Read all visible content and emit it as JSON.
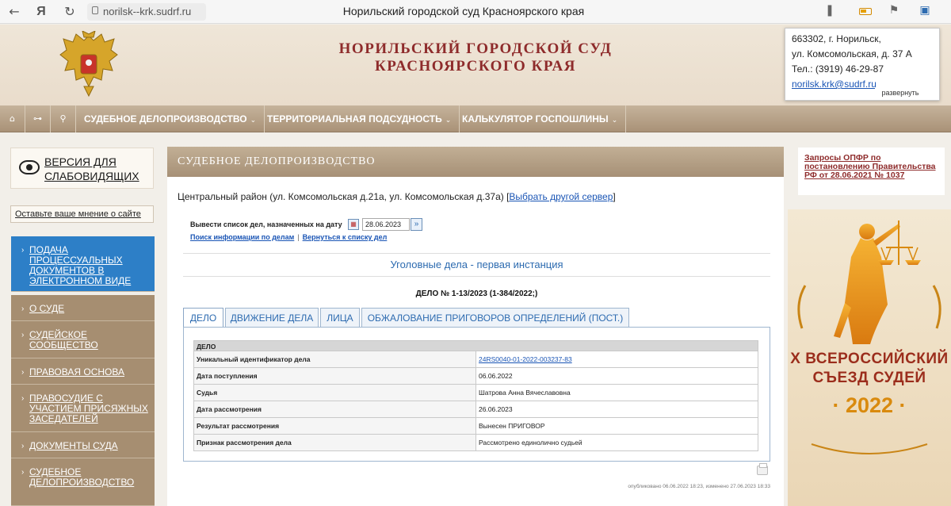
{
  "browser": {
    "url": "norilsk--krk.sudrf.ru",
    "tab_title": "Норильский городской суд Красноярского края"
  },
  "header": {
    "title_line1": "НОРИЛЬСКИЙ ГОРОДСКОЙ СУД",
    "title_line2": "КРАСНОЯРСКОГО КРАЯ",
    "contact": {
      "address1": "663302, г. Норильск,",
      "address2": "ул. Комсомольская, д. 37 А",
      "phone": "Тел.: (3919) 46-29-87",
      "email": "norilsk.krk@sudrf.ru",
      "expand_label": "развернуть"
    }
  },
  "topmenu": {
    "items": [
      "СУДЕБНОЕ ДЕЛОПРОИЗВОДСТВО",
      "ТЕРРИТОРИАЛЬНАЯ ПОДСУДНОСТЬ",
      "КАЛЬКУЛЯТОР ГОСПОШЛИНЫ"
    ],
    "chevron": "⌄"
  },
  "left": {
    "visually_impaired_line1": "ВЕРСИЯ ДЛЯ",
    "visually_impaired_line2": "СЛАБОВИДЯЩИХ",
    "feedback": "Оставьте ваше мнение о сайте",
    "nav": [
      {
        "lines": [
          "ПОДАЧА",
          "ПРОЦЕССУАЛЬНЫХ",
          "ДОКУМЕНТОВ В",
          "ЭЛЕКТРОННОМ ВИДЕ"
        ],
        "active": true
      },
      {
        "lines": [
          "О СУДЕ"
        ],
        "active": false
      },
      {
        "lines": [
          "СУДЕЙСКОЕ",
          "СООБЩЕСТВО"
        ],
        "active": false
      },
      {
        "lines": [
          "ПРАВОВАЯ ОСНОВА"
        ],
        "active": false
      },
      {
        "lines": [
          "ПРАВОСУДИЕ С",
          "УЧАСТИЕМ ПРИСЯЖНЫХ",
          "ЗАСЕДАТЕЛЕЙ"
        ],
        "active": false
      },
      {
        "lines": [
          "ДОКУМЕНТЫ СУДА"
        ],
        "active": false
      },
      {
        "lines": [
          "СУДЕБНОЕ",
          "ДЕЛОПРОИЗВОДСТВО"
        ],
        "active": false
      }
    ]
  },
  "main": {
    "heading": "СУДЕБНОЕ ДЕЛОПРОИЗВОДСТВО",
    "server_text": "Центральный район (ул. Комсомольская д.21а, ул. Комсомольская д.37а) [",
    "server_link": "Выбрать другой сервер",
    "server_text_end": "]",
    "date_label": "Вывести список дел, назначенных на дату",
    "date_value": "28.06.2023",
    "search_link": "Поиск информации по делам",
    "back_link": "Вернуться к списку дел",
    "section_title": "Уголовные дела - первая инстанция",
    "case_title": "ДЕЛО № 1-13/2023 (1-384/2022;)",
    "tabs": [
      "ДЕЛО",
      "ДВИЖЕНИЕ ДЕЛА",
      "ЛИЦА",
      "ОБЖАЛОВАНИЕ ПРИГОВОРОВ ОПРЕДЕЛЕНИЙ (ПОСТ.)"
    ],
    "table_header": "ДЕЛО",
    "rows": [
      {
        "label": "Уникальный идентификатор дела",
        "value": "24RS0040-01-2022-003237-83",
        "link": true
      },
      {
        "label": "Дата поступления",
        "value": "06.06.2022",
        "link": false
      },
      {
        "label": "Судья",
        "value": "Шатрова Анна Вячеславовна",
        "link": false
      },
      {
        "label": "Дата рассмотрения",
        "value": "26.06.2023",
        "link": false
      },
      {
        "label": "Результат рассмотрения",
        "value": "Вынесен ПРИГОВОР",
        "link": false
      },
      {
        "label": "Признак рассмотрения дела",
        "value": "Рассмотрено единолично судьей",
        "link": false
      }
    ],
    "published": "опубликовано 06.06.2022 18:23, изменено 27.06.2023 18:33"
  },
  "right": {
    "link_text": "Запросы ОПФР по постановлению Правительства РФ от 28.06.2021 № 1037",
    "banner_line1": "X ВСЕРОССИЙСКИЙ",
    "banner_line2": "СЪЕЗД СУДЕЙ",
    "banner_year": "· 2022 ·"
  },
  "colors": {
    "brand_red": "#8e2b2b",
    "menu_tan": "#a68e71",
    "active_blue": "#2d7fc7",
    "link_blue": "#1a55b5"
  }
}
